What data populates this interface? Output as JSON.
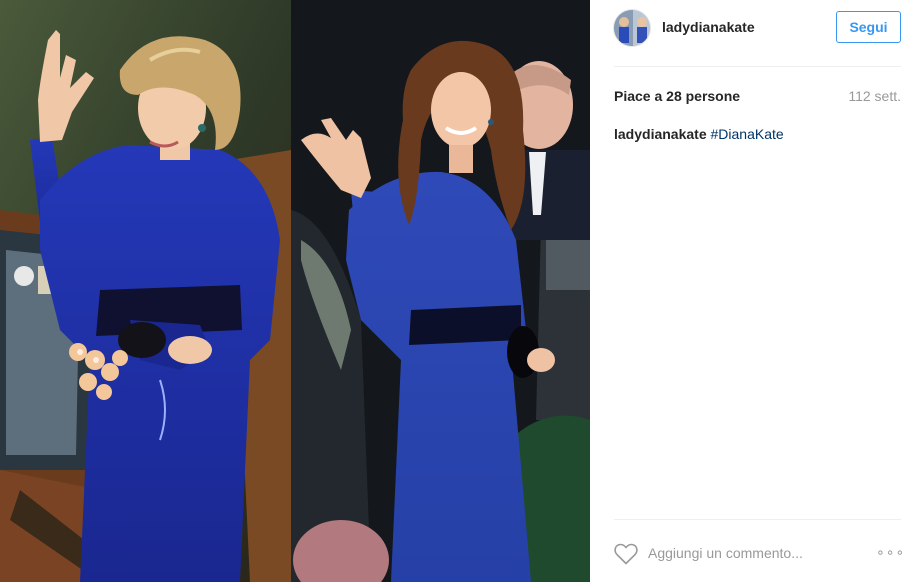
{
  "post": {
    "username": "ladydianakate",
    "follow_label": "Segui",
    "likes_text": "Piace a 28 persone",
    "time_ago": "112 sett.",
    "caption": {
      "user": "ladydianakate",
      "hashtag": "#DianaKate"
    },
    "comment_placeholder": "Aggiungi un commento...",
    "more_label": "∘∘∘"
  },
  "colors": {
    "accent_blue": "#3897f0",
    "hashtag": "#003569",
    "muted_text": "#999999",
    "dress_blue": "#1f2fa8"
  },
  "icons": [
    "heart-icon",
    "more-options-icon"
  ]
}
